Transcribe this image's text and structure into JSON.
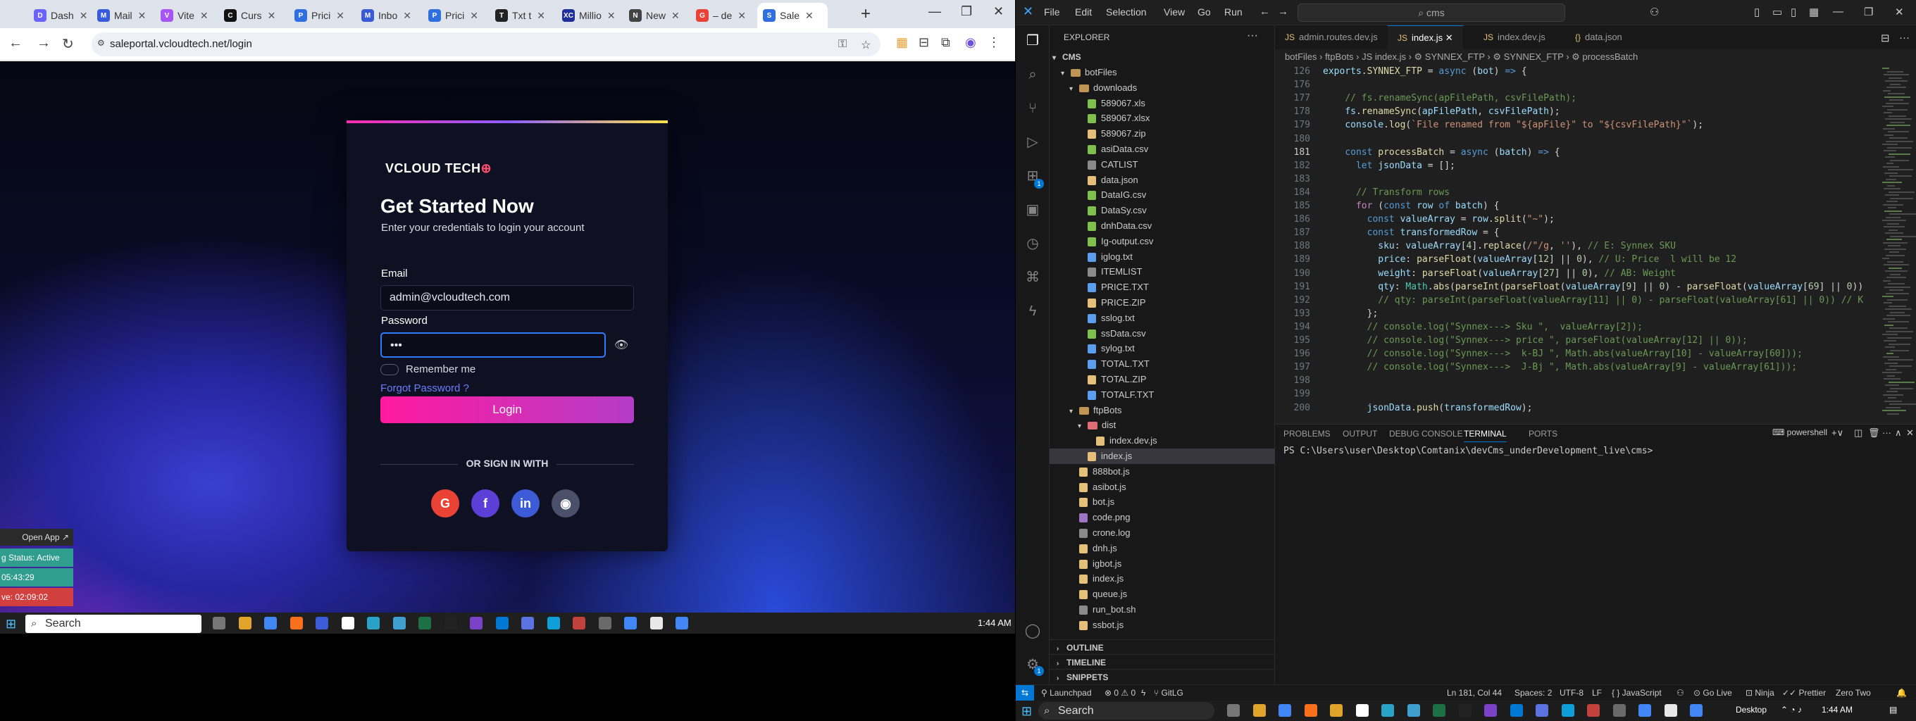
{
  "chrome": {
    "tabs": [
      {
        "label": "Dash",
        "color": "#6c63ff",
        "glyph": "D"
      },
      {
        "label": "Mail",
        "color": "#3a5bd9",
        "glyph": "M"
      },
      {
        "label": "Vite",
        "color": "#a855f7",
        "glyph": "V"
      },
      {
        "label": "Curs",
        "color": "#111111",
        "glyph": "C"
      },
      {
        "label": "Prici",
        "color": "#2f6fe0",
        "glyph": "P"
      },
      {
        "label": "Inbo",
        "color": "#3a5bd9",
        "glyph": "M"
      },
      {
        "label": "Prici",
        "color": "#2f6fe0",
        "glyph": "P"
      },
      {
        "label": "Txt t",
        "color": "#222222",
        "glyph": "T"
      },
      {
        "label": "Millio",
        "color": "#1f2f99",
        "glyph": "XC"
      },
      {
        "label": "New",
        "color": "#444444",
        "glyph": "N"
      },
      {
        "label": "– de",
        "color": "#ea4335",
        "glyph": "G"
      },
      {
        "label": "Sale",
        "color": "#2f6fe0",
        "glyph": "S"
      }
    ],
    "url": "saleportal.vcloudtech.net/login"
  },
  "login": {
    "logo_text": "VCLOUD TECH",
    "title": "Get Started Now",
    "subtitle": "Enter your credentials to login your account",
    "email_label": "Email",
    "email_value": "admin@vcloudtech.com",
    "password_label": "Password",
    "password_value": "•••",
    "remember_label": "Remember me",
    "forgot_label": "Forgot Password ?",
    "login_button": "Login",
    "or_text": "OR SIGN IN WITH",
    "socials": [
      {
        "name": "google",
        "glyph": "G",
        "color": "#ea4335"
      },
      {
        "name": "facebook",
        "glyph": "f",
        "color": "#5b3fd6"
      },
      {
        "name": "linkedin",
        "glyph": "in",
        "color": "#3d5bd6"
      },
      {
        "name": "github",
        "glyph": "◉",
        "color": "#4a4f6a"
      }
    ]
  },
  "overlay": {
    "open_app": "Open App ↗",
    "status": "g Status: Active",
    "time1": "05:43:29",
    "time2": "ve: 02:09:02"
  },
  "left_taskbar": {
    "search": "Search",
    "time": "1:44 AM"
  },
  "vscode": {
    "menu": [
      "File",
      "Edit",
      "Selection",
      "View",
      "Go",
      "Run",
      "···"
    ],
    "command_center": "cms",
    "explorer_title": "EXPLORER",
    "root": "CMS",
    "tree": [
      {
        "label": "botFiles",
        "type": "folder",
        "depth": 1,
        "open": true
      },
      {
        "label": "downloads",
        "type": "folder",
        "depth": 2,
        "open": true
      },
      {
        "label": "589067.xls",
        "type": "file",
        "depth": 3,
        "color": "#7fbf4d"
      },
      {
        "label": "589067.xlsx",
        "type": "file",
        "depth": 3,
        "color": "#7fbf4d"
      },
      {
        "label": "589067.zip",
        "type": "file",
        "depth": 3,
        "color": "#e5c07b"
      },
      {
        "label": "asiData.csv",
        "type": "file",
        "depth": 3,
        "color": "#7fbf4d"
      },
      {
        "label": "CATLIST",
        "type": "file",
        "depth": 3,
        "color": "#8a8a8a"
      },
      {
        "label": "data.json",
        "type": "file",
        "depth": 3,
        "color": "#e5c07b"
      },
      {
        "label": "DataIG.csv",
        "type": "file",
        "depth": 3,
        "color": "#7fbf4d"
      },
      {
        "label": "DataSy.csv",
        "type": "file",
        "depth": 3,
        "color": "#7fbf4d"
      },
      {
        "label": "dnhData.csv",
        "type": "file",
        "depth": 3,
        "color": "#7fbf4d"
      },
      {
        "label": "Ig-output.csv",
        "type": "file",
        "depth": 3,
        "color": "#7fbf4d"
      },
      {
        "label": "iglog.txt",
        "type": "file",
        "depth": 3,
        "color": "#5c9ded"
      },
      {
        "label": "ITEMLIST",
        "type": "file",
        "depth": 3,
        "color": "#8a8a8a"
      },
      {
        "label": "PRICE.TXT",
        "type": "file",
        "depth": 3,
        "color": "#5c9ded"
      },
      {
        "label": "PRICE.ZIP",
        "type": "file",
        "depth": 3,
        "color": "#e5c07b"
      },
      {
        "label": "sslog.txt",
        "type": "file",
        "depth": 3,
        "color": "#5c9ded"
      },
      {
        "label": "ssData.csv",
        "type": "file",
        "depth": 3,
        "color": "#7fbf4d"
      },
      {
        "label": "sylog.txt",
        "type": "file",
        "depth": 3,
        "color": "#5c9ded"
      },
      {
        "label": "TOTAL.TXT",
        "type": "file",
        "depth": 3,
        "color": "#5c9ded"
      },
      {
        "label": "TOTAL.ZIP",
        "type": "file",
        "depth": 3,
        "color": "#e5c07b"
      },
      {
        "label": "TOTALF.TXT",
        "type": "file",
        "depth": 3,
        "color": "#5c9ded"
      },
      {
        "label": "ftpBots",
        "type": "folder",
        "depth": 2,
        "open": true
      },
      {
        "label": "dist",
        "type": "folder",
        "depth": 3,
        "open": true,
        "red": true
      },
      {
        "label": "index.dev.js",
        "type": "file",
        "depth": 4,
        "color": "#e5c07b"
      },
      {
        "label": "index.js",
        "type": "file",
        "depth": 3,
        "color": "#e5c07b",
        "selected": true
      },
      {
        "label": "888bot.js",
        "type": "file",
        "depth": 2,
        "color": "#e5c07b"
      },
      {
        "label": "asibot.js",
        "type": "file",
        "depth": 2,
        "color": "#e5c07b"
      },
      {
        "label": "bot.js",
        "type": "file",
        "depth": 2,
        "color": "#e5c07b"
      },
      {
        "label": "code.png",
        "type": "file",
        "depth": 2,
        "color": "#a074c4"
      },
      {
        "label": "crone.log",
        "type": "file",
        "depth": 2,
        "color": "#8a8a8a"
      },
      {
        "label": "dnh.js",
        "type": "file",
        "depth": 2,
        "color": "#e5c07b"
      },
      {
        "label": "igbot.js",
        "type": "file",
        "depth": 2,
        "color": "#e5c07b"
      },
      {
        "label": "index.js",
        "type": "file",
        "depth": 2,
        "color": "#e5c07b"
      },
      {
        "label": "queue.js",
        "type": "file",
        "depth": 2,
        "color": "#e5c07b"
      },
      {
        "label": "run_bot.sh",
        "type": "file",
        "depth": 2,
        "color": "#8a8a8a"
      },
      {
        "label": "ssbot.js",
        "type": "file",
        "depth": 2,
        "color": "#e5c07b"
      }
    ],
    "sections": [
      "OUTLINE",
      "TIMELINE",
      "SNIPPETS"
    ],
    "tabs": [
      {
        "label": "admin.routes.dev.js",
        "active": false,
        "glyph": "JS"
      },
      {
        "label": "index.js",
        "active": true,
        "glyph": "JS"
      },
      {
        "label": "index.dev.js",
        "active": false,
        "glyph": "JS"
      },
      {
        "label": "data.json",
        "active": false,
        "glyph": "{}"
      }
    ],
    "breadcrumb": "botFiles  ›  ftpBots  ›  JS index.js  ›  ⚙ SYNNEX_FTP  ›  ⚙ SYNNEX_FTP  ›  ⚙ processBatch",
    "code": [
      {
        "n": "126",
        "html": "<span class='vr'>exports</span><span class='pu'>.</span><span class='fn'>SYNNEX_FTP</span><span class='pu'> = </span><span class='kw'>async</span><span class='pu'> (</span><span class='vr'>bot</span><span class='pu'>) </span><span class='kw'>=&gt;</span><span class='pu'> {</span>"
      },
      {
        "n": "176",
        "html": ""
      },
      {
        "n": "177",
        "html": "    <span class='cm'>// fs.renameSync(apFilePath, csvFilePath);</span>"
      },
      {
        "n": "178",
        "html": "    <span class='vr'>fs</span><span class='pu'>.</span><span class='fn'>renameSync</span><span class='pu'>(</span><span class='vr'>apFilePath</span><span class='pu'>, </span><span class='vr'>csvFilePath</span><span class='pu'>);</span>"
      },
      {
        "n": "179",
        "html": "    <span class='vr'>console</span><span class='pu'>.</span><span class='fn'>log</span><span class='pu'>(</span><span class='str'>`File renamed from \"${apFile}\" to \"${csvFilePath}\"`</span><span class='pu'>);</span>"
      },
      {
        "n": "180",
        "html": ""
      },
      {
        "n": "181",
        "html": "    <span class='kw'>const</span><span class='pu'> </span><span class='fn'>processBatch</span><span class='pu'> = </span><span class='kw'>async</span><span class='pu'> (</span><span class='vr'>batch</span><span class='pu'>) </span><span class='kw'>=&gt;</span><span class='pu'> {</span>",
        "current": true
      },
      {
        "n": "182",
        "html": "      <span class='kw'>let</span><span class='pu'> </span><span class='vr'>jsonData</span><span class='pu'> = [];</span>"
      },
      {
        "n": "183",
        "html": ""
      },
      {
        "n": "184",
        "html": "      <span class='cm'>// Transform rows</span>"
      },
      {
        "n": "185",
        "html": "      <span class='kw2'>for</span><span class='pu'> (</span><span class='kw'>const</span><span class='pu'> </span><span class='vr'>row</span><span class='pu'> </span><span class='kw'>of</span><span class='pu'> </span><span class='vr'>batch</span><span class='pu'>) {</span>"
      },
      {
        "n": "186",
        "html": "        <span class='kw'>const</span><span class='pu'> </span><span class='vr'>valueArray</span><span class='pu'> = </span><span class='vr'>row</span><span class='pu'>.</span><span class='fn'>split</span><span class='pu'>(</span><span class='str'>\"~\"</span><span class='pu'>);</span>"
      },
      {
        "n": "187",
        "html": "        <span class='kw'>const</span><span class='pu'> </span><span class='vr'>transformedRow</span><span class='pu'> = {</span>"
      },
      {
        "n": "188",
        "html": "          <span class='vr'>sku</span><span class='pu'>: </span><span class='vr'>valueArray</span><span class='pu'>[</span><span class='nm'>4</span><span class='pu'>].</span><span class='fn'>replace</span><span class='pu'>(</span><span class='str'>/\"/g</span><span class='pu'>, </span><span class='str'>''</span><span class='pu'>), </span><span class='cm'>// E: Synnex SKU</span>"
      },
      {
        "n": "189",
        "html": "          <span class='vr'>price</span><span class='pu'>: </span><span class='fn'>parseFloat</span><span class='pu'>(</span><span class='vr'>valueArray</span><span class='pu'>[</span><span class='nm'>12</span><span class='pu'>] || </span><span class='nm'>0</span><span class='pu'>), </span><span class='cm'>// U: Price  l will be 12</span>"
      },
      {
        "n": "190",
        "html": "          <span class='vr'>weight</span><span class='pu'>: </span><span class='fn'>parseFloat</span><span class='pu'>(</span><span class='vr'>valueArray</span><span class='pu'>[</span><span class='nm'>27</span><span class='pu'>] || </span><span class='nm'>0</span><span class='pu'>), </span><span class='cm'>// AB: Weight</span>"
      },
      {
        "n": "191",
        "html": "          <span class='vr'>qty</span><span class='pu'>: </span><span class='cl'>Math</span><span class='pu'>.</span><span class='fn'>abs</span><span class='pu'>(</span><span class='fn'>parseInt</span><span class='pu'>(</span><span class='fn'>parseFloat</span><span class='pu'>(</span><span class='vr'>valueArray</span><span class='pu'>[</span><span class='nm'>9</span><span class='pu'>] || </span><span class='nm'>0</span><span class='pu'>) - </span><span class='fn'>parseFloat</span><span class='pu'>(</span><span class='vr'>valueArray</span><span class='pu'>[</span><span class='nm'>69</span><span class='pu'>] || </span><span class='nm'>0</span><span class='pu'>))</span>"
      },
      {
        "n": "192",
        "html": "          <span class='cm'>// qty: parseInt(parseFloat(valueArray[11] || 0) - parseFloat(valueArray[61] || 0)) // K</span>"
      },
      {
        "n": "193",
        "html": "        <span class='pu'>};</span>"
      },
      {
        "n": "194",
        "html": "        <span class='cm'>// console.log(\"Synnex---&gt; Sku \",  valueArray[2]);</span>"
      },
      {
        "n": "195",
        "html": "        <span class='cm'>// console.log(\"Synnex---&gt; price \", parseFloat(valueArray[12] || 0));</span>"
      },
      {
        "n": "196",
        "html": "        <span class='cm'>// console.log(\"Synnex---&gt;  k-BJ \", Math.abs(valueArray[10] - valueArray[60]));</span>"
      },
      {
        "n": "197",
        "html": "        <span class='cm'>// console.log(\"Synnex---&gt;  J-Bj \", Math.abs(valueArray[9] - valueArray[61]));</span>"
      },
      {
        "n": "198",
        "html": ""
      },
      {
        "n": "199",
        "html": ""
      },
      {
        "n": "200",
        "html": "        <span class='vr'>jsonData</span><span class='pu'>.</span><span class='fn'>push</span><span class='pu'>(</span><span class='vr'>transformedRow</span><span class='pu'>);</span>"
      }
    ],
    "panel_tabs": [
      "PROBLEMS",
      "OUTPUT",
      "DEBUG CONSOLE",
      "TERMINAL",
      "PORTS"
    ],
    "panel_active": "TERMINAL",
    "terminal_shell": "powershell",
    "terminal_prompt": "PS C:\\Users\\user\\Desktop\\Comtanix\\devCms_underDevelopment_live\\cms>",
    "status": {
      "launchpad": "Launchpad",
      "errors": "⊗ 0 ⚠ 0",
      "gitlg": "GitLG",
      "position": "Ln 181, Col 44",
      "spaces": "Spaces: 2",
      "encoding": "UTF-8",
      "eol": "LF",
      "language": "{ } JavaScript",
      "golive": "Go Live",
      "ninja": "Ninja",
      "prettier": "Prettier",
      "zerotwo": "Zero Two"
    }
  },
  "right_taskbar": {
    "search": "Search",
    "desktop": "Desktop",
    "time": "1:44 AM"
  }
}
